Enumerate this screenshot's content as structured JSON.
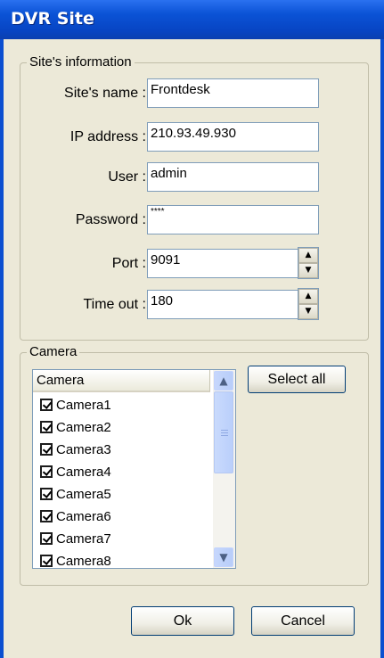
{
  "window": {
    "title": "DVR Site"
  },
  "site_info": {
    "legend": "Site's information",
    "site_name_label": "Site's name :",
    "site_name_value": "Frontdesk",
    "ip_label": "IP address :",
    "ip_value": "210.93.49.930",
    "user_label": "User :",
    "user_value": "admin",
    "password_label": "Password :",
    "password_value": "****",
    "port_label": "Port :",
    "port_value": "9091",
    "timeout_label": "Time out :",
    "timeout_value": "180"
  },
  "camera": {
    "legend": "Camera",
    "column_header": "Camera",
    "select_all_label": "Select all",
    "items": [
      {
        "label": "Camera1",
        "checked": true
      },
      {
        "label": "Camera2",
        "checked": true
      },
      {
        "label": "Camera3",
        "checked": true
      },
      {
        "label": "Camera4",
        "checked": true
      },
      {
        "label": "Camera5",
        "checked": true
      },
      {
        "label": "Camera6",
        "checked": true
      },
      {
        "label": "Camera7",
        "checked": true
      },
      {
        "label": "Camera8",
        "checked": true
      }
    ]
  },
  "buttons": {
    "ok_label": "Ok",
    "cancel_label": "Cancel"
  },
  "icons": {
    "spin_up": "spin-up-arrow-icon",
    "spin_down": "spin-down-arrow-icon",
    "scroll_up": "scroll-up-arrow-icon",
    "scroll_down": "scroll-down-arrow-icon",
    "checkbox": "checkbox-checked-icon"
  },
  "colors": {
    "titlebar": "#0b53d6",
    "dialog_bg": "#ece9d8",
    "field_border": "#7f9db9"
  }
}
